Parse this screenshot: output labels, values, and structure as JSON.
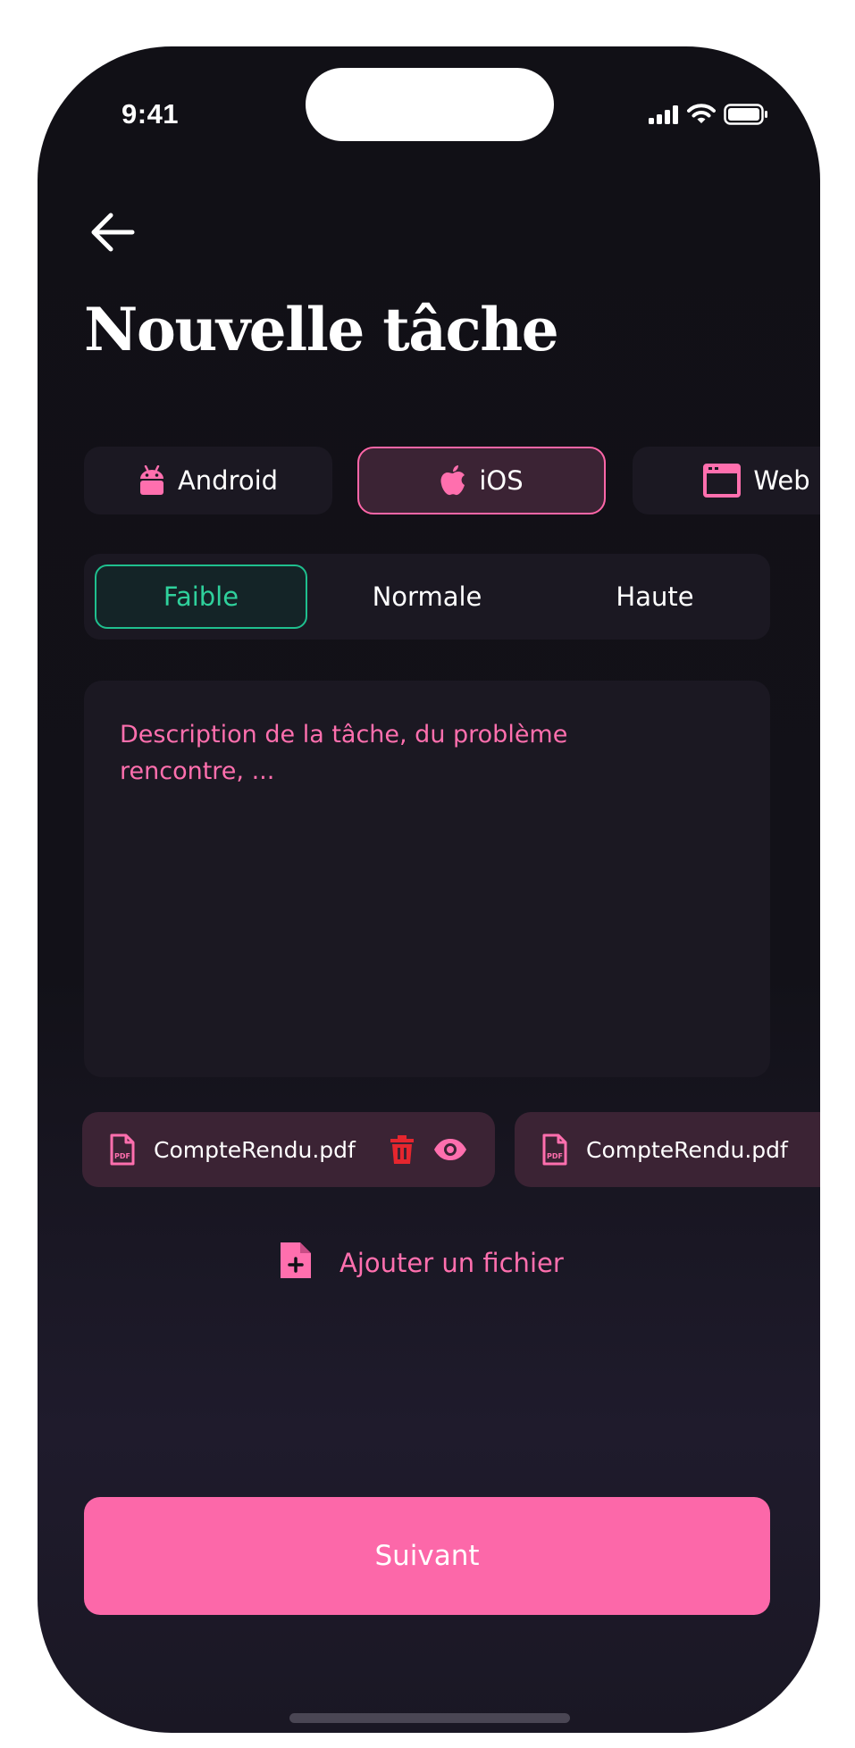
{
  "status_bar": {
    "time": "9:41",
    "icons": [
      "signal-icon",
      "wifi-icon",
      "battery-icon"
    ]
  },
  "header": {
    "back_icon": "arrow-left-icon",
    "title": "Nouvelle tâche"
  },
  "platforms": {
    "selected": "iOS",
    "items": [
      {
        "label": "Android",
        "icon": "android-icon"
      },
      {
        "label": "iOS",
        "icon": "apple-icon"
      },
      {
        "label": "Web",
        "icon": "browser-window-icon"
      }
    ]
  },
  "priority": {
    "selected": "Faible",
    "options": [
      "Faible",
      "Normale",
      "Haute"
    ]
  },
  "description": {
    "value": "",
    "placeholder": "Description de la tâche, du problème\nrencontre, ..."
  },
  "attachments": [
    {
      "name": "CompteRendu.pdf",
      "icon": "pdf-file-icon",
      "actions": [
        "trash-icon",
        "eye-icon"
      ]
    },
    {
      "name": "CompteRendu.pdf",
      "icon": "pdf-file-icon",
      "actions": []
    }
  ],
  "add_file": {
    "label": "Ajouter un fichier",
    "icon": "file-plus-icon"
  },
  "footer": {
    "next_label": "Suivant"
  },
  "colors": {
    "accent_pink": "#fc68a9",
    "pink_text": "#ff6fae",
    "green_selected": "#1fbf8e",
    "background": "#111016",
    "surface": "#1b1822",
    "chip_pink_bg": "#3b2334",
    "danger_red": "#e5262e"
  }
}
